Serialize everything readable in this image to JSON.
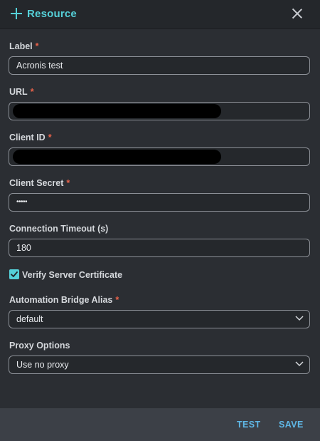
{
  "header": {
    "title": "Resource",
    "add_icon": "plus-icon",
    "close_icon": "close-icon"
  },
  "form": {
    "required_marker": "*",
    "label": {
      "label": "Label",
      "value": "Acronis test"
    },
    "url": {
      "label": "URL",
      "value": ""
    },
    "client_id": {
      "label": "Client ID",
      "value": ""
    },
    "client_secret": {
      "label": "Client Secret",
      "value": "•••••"
    },
    "timeout": {
      "label": "Connection Timeout (s)",
      "value": "180"
    },
    "verify_cert": {
      "label": "Verify Server Certificate",
      "checked": true
    },
    "bridge_alias": {
      "label": "Automation Bridge Alias",
      "selected": "default"
    },
    "proxy": {
      "label": "Proxy Options",
      "selected": "Use no proxy"
    }
  },
  "footer": {
    "test_label": "TEST",
    "save_label": "SAVE"
  },
  "colors": {
    "accent": "#55d0d8",
    "required": "#e8624a",
    "footer_action": "#5fb7e6",
    "background": "#2b2e33"
  }
}
